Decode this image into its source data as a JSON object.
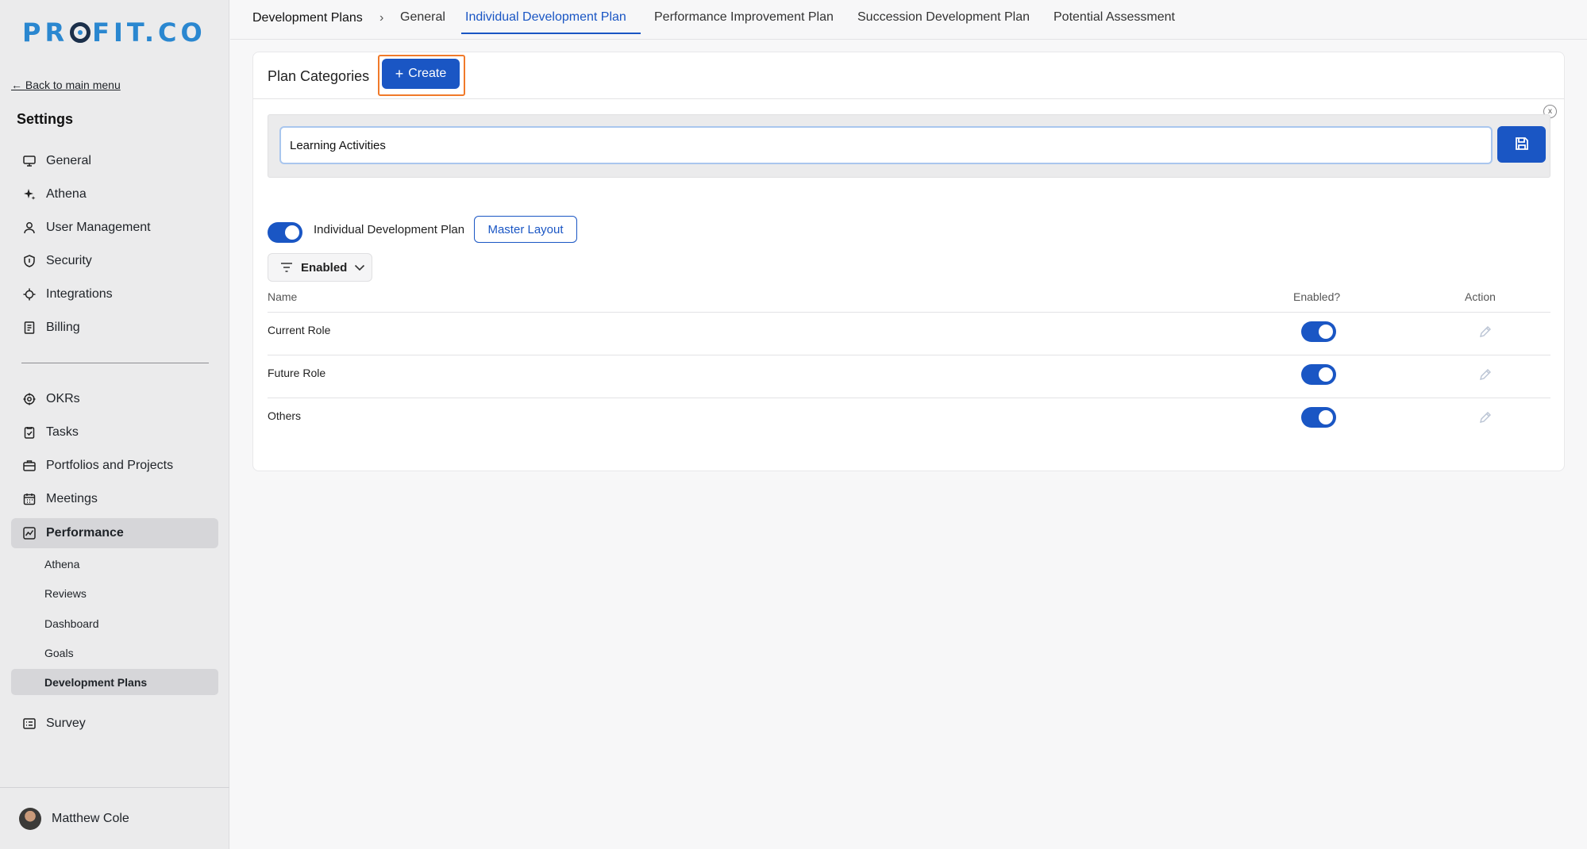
{
  "brand": {
    "logo_text_left": "PR",
    "logo_text_right": "FIT.CO",
    "primary_color": "#1a56c4",
    "highlight_color": "#f07a2a"
  },
  "sidebar": {
    "back_link": "← Back to main menu",
    "title": "Settings",
    "items": [
      {
        "label": "General",
        "icon": "monitor-icon"
      },
      {
        "label": "Athena",
        "icon": "sparkle-icon"
      },
      {
        "label": "User Management",
        "icon": "user-icon"
      },
      {
        "label": "Security",
        "icon": "shield-icon"
      },
      {
        "label": "Integrations",
        "icon": "puzzle-icon"
      },
      {
        "label": "Billing",
        "icon": "receipt-icon"
      }
    ],
    "modules": [
      {
        "label": "OKRs",
        "icon": "target-icon"
      },
      {
        "label": "Tasks",
        "icon": "clipboard-check-icon"
      },
      {
        "label": "Portfolios and Projects",
        "icon": "briefcase-icon"
      },
      {
        "label": "Meetings",
        "icon": "calendar-icon"
      },
      {
        "label": "Performance",
        "icon": "chart-line-icon"
      },
      {
        "label": "Survey",
        "icon": "list-icon"
      }
    ],
    "performance_sub": [
      "Athena",
      "Reviews",
      "Dashboard",
      "Goals",
      "Development Plans"
    ],
    "user": {
      "name": "Matthew Cole"
    }
  },
  "topbar": {
    "breadcrumb": "Development Plans",
    "separator": "›",
    "tabs": [
      "General",
      "Individual Development Plan",
      "Performance Improvement Plan",
      "Succession Development Plan",
      "Potential Assessment"
    ],
    "active_tab": "Individual Development Plan"
  },
  "card": {
    "title": "Plan Categories",
    "create_label": "Create",
    "close_label": "x",
    "input_value": "Learning Activities",
    "idp_toggle_label": "Individual Development Plan",
    "idp_enabled": true,
    "master_layout_label": "Master Layout",
    "filter_label": "Enabled"
  },
  "table": {
    "headers": {
      "name": "Name",
      "enabled": "Enabled?",
      "action": "Action"
    },
    "rows": [
      {
        "name": "Current Role",
        "enabled": true
      },
      {
        "name": "Future Role",
        "enabled": true
      },
      {
        "name": "Others",
        "enabled": true
      }
    ]
  }
}
